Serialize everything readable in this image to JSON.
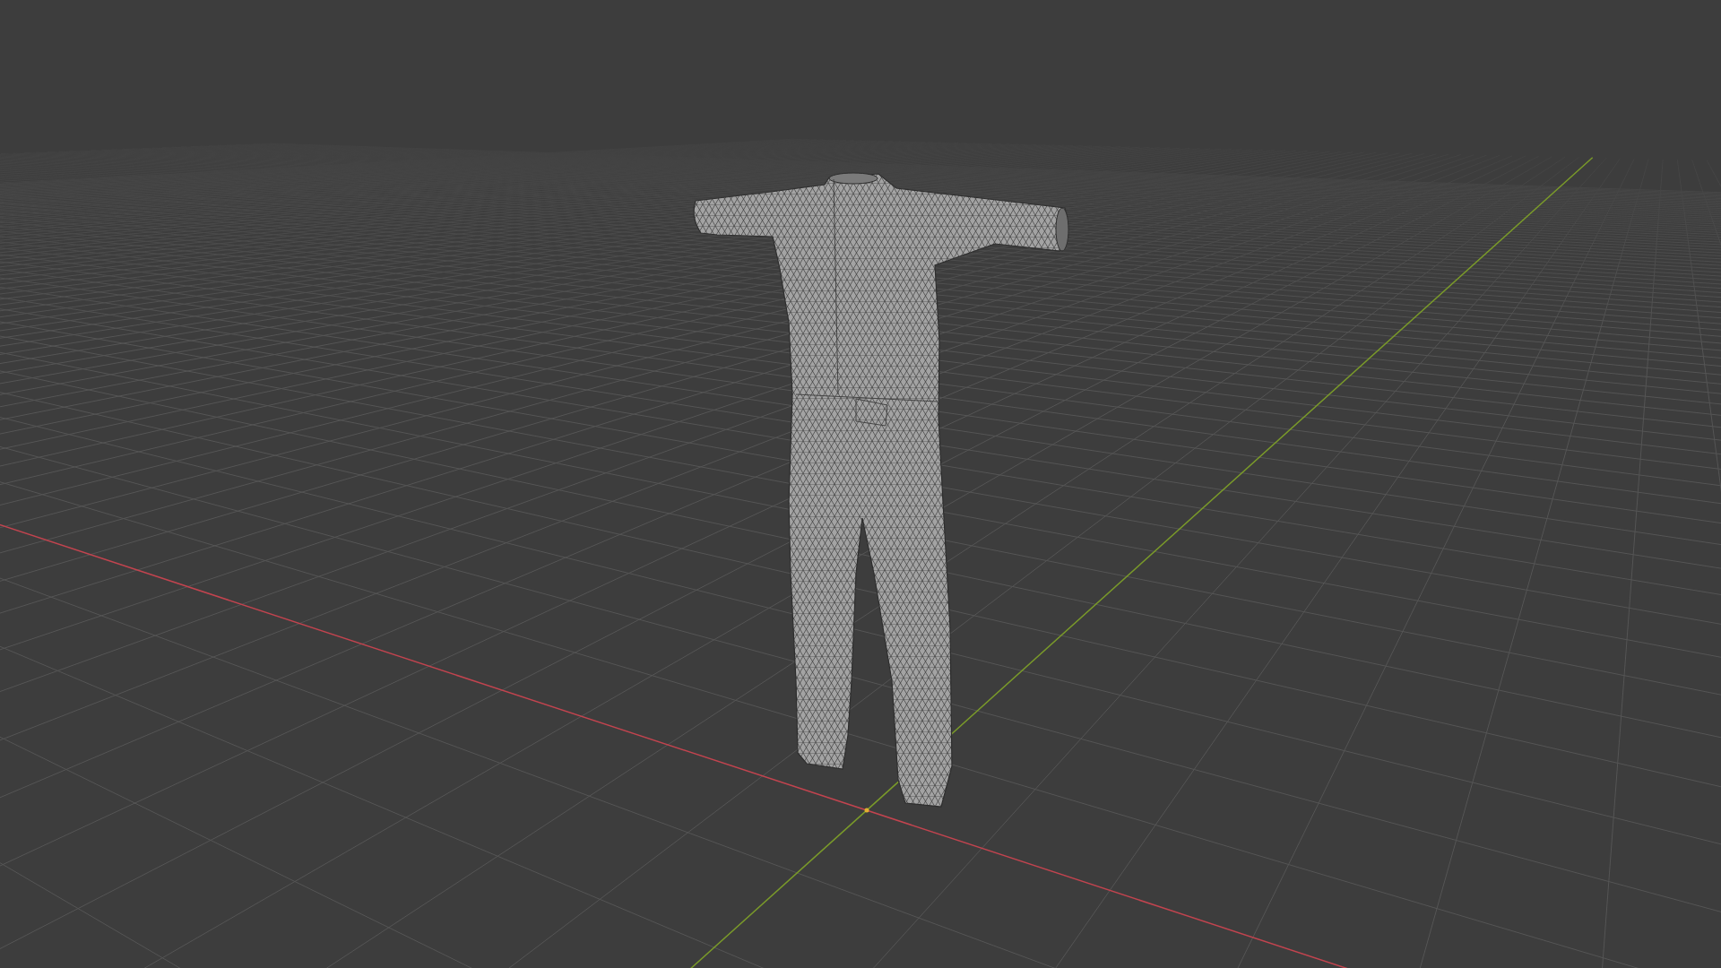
{
  "viewport": {
    "kind": "scene_3d"
  }
}
